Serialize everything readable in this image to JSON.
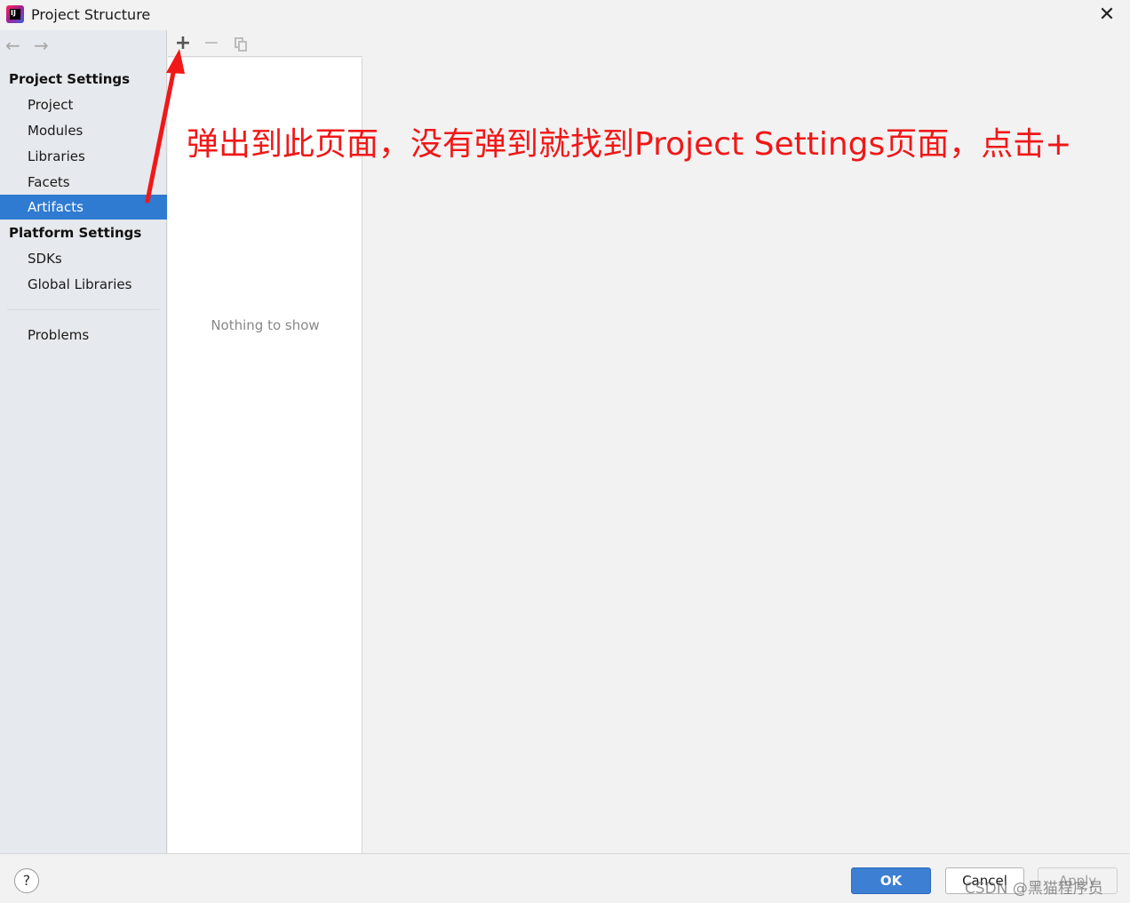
{
  "window": {
    "title": "Project Structure",
    "app_icon_text": "IJ",
    "close_glyph": "✕"
  },
  "nav": {
    "back_glyph": "←",
    "forward_glyph": "→"
  },
  "sidebar": {
    "project_settings_header": "Project Settings",
    "project_settings_items": [
      {
        "label": "Project"
      },
      {
        "label": "Modules"
      },
      {
        "label": "Libraries"
      },
      {
        "label": "Facets"
      },
      {
        "label": "Artifacts",
        "selected": true
      }
    ],
    "platform_settings_header": "Platform Settings",
    "platform_settings_items": [
      {
        "label": "SDKs"
      },
      {
        "label": "Global Libraries"
      }
    ],
    "problems_label": "Problems"
  },
  "toolbar": {
    "add_glyph": "+",
    "remove_glyph": "−"
  },
  "list": {
    "empty_text": "Nothing to show"
  },
  "annotation": {
    "text": "弹出到此页面，没有弹到就找到Project Settings页面，点击+",
    "color": "#f01818"
  },
  "footer": {
    "help_glyph": "?",
    "ok_label": "OK",
    "cancel_label": "Cancel",
    "apply_label": "Apply",
    "watermark": "CSDN @黑猫程序员"
  },
  "colors": {
    "accent": "#2f7bd1",
    "sidebar_bg": "#e6e9ed",
    "ok_button": "#3c7fd3"
  }
}
